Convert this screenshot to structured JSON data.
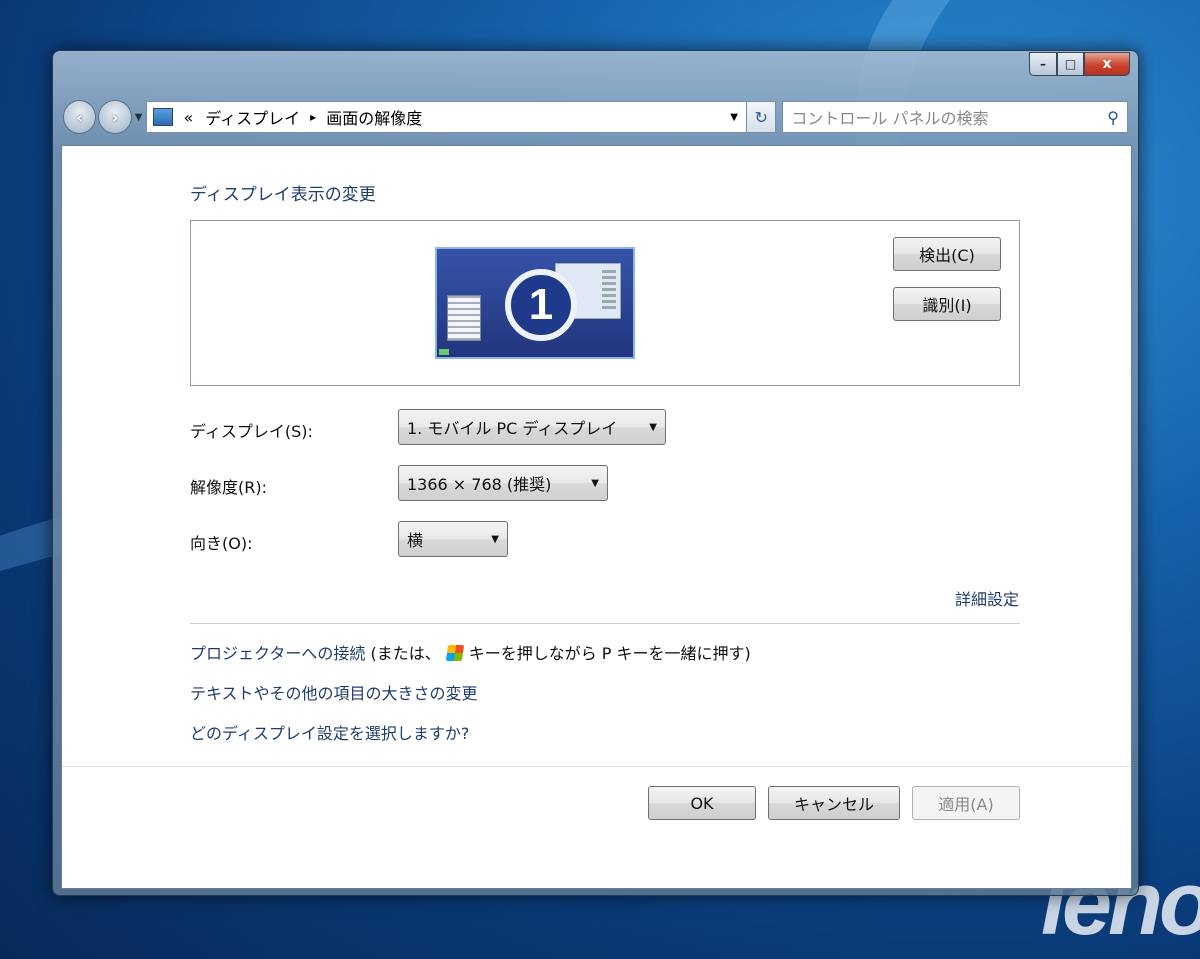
{
  "window": {
    "buttons": {
      "minimize": "–",
      "maximize": "□",
      "close": "x"
    }
  },
  "nav": {
    "back_icon": "back-arrow-icon",
    "forward_icon": "forward-arrow-icon",
    "breadcrumb_prefix": "«",
    "breadcrumbs": [
      "ディスプレイ",
      "画面の解像度"
    ],
    "search_placeholder": "コントロール パネルの検索"
  },
  "main": {
    "heading": "ディスプレイ表示の変更",
    "monitor_number": "1",
    "detect_button": "検出(C)",
    "identify_button": "識別(I)",
    "display_label": "ディスプレイ(S):",
    "display_value": "1. モバイル PC ディスプレイ",
    "resolution_label": "解像度(R):",
    "resolution_value": "1366 × 768 (推奨)",
    "orientation_label": "向き(O):",
    "orientation_value": "横",
    "advanced_link": "詳細設定",
    "projector_link": "プロジェクターへの接続",
    "projector_text_before": " (または、",
    "projector_text_after": "キーを押しながら P キーを一緒に押す)",
    "text_size_link": "テキストやその他の項目の大きさの変更",
    "which_display_link": "どのディスプレイ設定を選択しますか?"
  },
  "footer": {
    "ok": "OK",
    "cancel": "キャンセル",
    "apply": "適用(A)"
  },
  "desktop": {
    "brand_text": "leno"
  },
  "colors": {
    "link": "#1e3d6b",
    "desktop_blue": "#1560a8",
    "close_red": "#c8452e"
  }
}
